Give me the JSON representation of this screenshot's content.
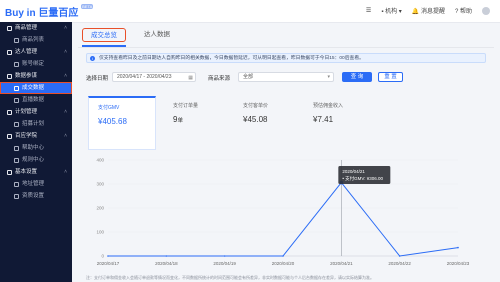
{
  "brand": {
    "name_a": "Buy in",
    "name_b": "巨量百应",
    "tag": "BETA"
  },
  "topbar": {
    "org": "机构",
    "messages": "消息提醒",
    "help": "帮助"
  },
  "sidebar": [
    {
      "group": "商品管理",
      "items": [
        "商品列表"
      ]
    },
    {
      "group": "达人管理",
      "items": [
        "账号绑定"
      ]
    },
    {
      "group": "数据参谋",
      "items": [
        "成交数据",
        "直播数据"
      ]
    },
    {
      "group": "计划管理",
      "items": [
        "招募计划"
      ]
    },
    {
      "group": "百应学院",
      "items": [
        "帮助中心",
        "规则中心"
      ]
    },
    {
      "group": "基本设置",
      "items": [
        "地址管理",
        "资质设置"
      ]
    }
  ],
  "tabs": [
    "成交总览",
    "达人数据"
  ],
  "notice": "仅支持查看昨日及之前日期达人自购昨日的相关数据，今日数据暂延迟，可从明日起查看，昨日数据可于今日15：00后查看。",
  "filters": {
    "date_label": "选择日期",
    "date_range": "2020/04/17 - 2020/04/23",
    "source_label": "商品来源",
    "source_value": "全部",
    "query": "查 询",
    "reset": "重 置"
  },
  "metrics": [
    {
      "label": "支付GMV",
      "value": "¥405.68"
    },
    {
      "label": "支付订单量",
      "value": "9",
      "unit": "单"
    },
    {
      "label": "支付客单价",
      "value": "¥45.08"
    },
    {
      "label": "预估佣金收入",
      "value": "¥7.41"
    }
  ],
  "chart_data": {
    "type": "line",
    "categories": [
      "2020/04/17",
      "2020/04/18",
      "2020/04/19",
      "2020/04/20",
      "2020/04/21",
      "2020/04/22",
      "2020/04/23"
    ],
    "series": [
      {
        "name": "支付GMV",
        "values": [
          0,
          0,
          0,
          0,
          306,
          0,
          35
        ]
      }
    ],
    "ylim": [
      0,
      400
    ],
    "yticks": [
      "0",
      "100",
      "200",
      "300",
      "400"
    ],
    "tooltip": {
      "date": "2020/04/21",
      "text": "• 支付GMV: ¥306.00"
    },
    "grid": true,
    "color": "#2b6cf6"
  },
  "footnote": "注：支付订单和佣金收入会随订单退款等情况而变化，不同数据所统计的时间范围可能会有所差异，非实时数据可能与个人后台数据存在差异，请以实际结算为准。"
}
